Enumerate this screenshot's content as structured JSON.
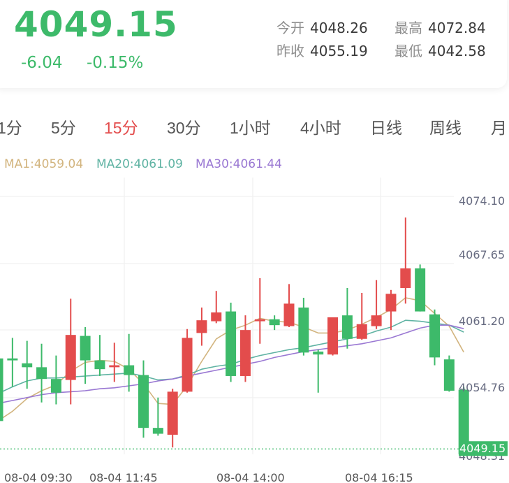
{
  "quote": {
    "price": "4049.15",
    "change": "-6.04",
    "change_pct": "-0.15%",
    "open_label": "今开",
    "open": "4048.26",
    "high_label": "最高",
    "high": "4072.84",
    "prev_close_label": "昨收",
    "prev_close": "4055.19",
    "low_label": "最低",
    "low": "4042.58"
  },
  "periods": [
    {
      "label": "1分",
      "active": false
    },
    {
      "label": "5分",
      "active": false
    },
    {
      "label": "15分",
      "active": true
    },
    {
      "label": "30分",
      "active": false
    },
    {
      "label": "1小时",
      "active": false
    },
    {
      "label": "4小时",
      "active": false
    },
    {
      "label": "日线",
      "active": false
    },
    {
      "label": "周线",
      "active": false
    },
    {
      "label": "月",
      "active": false
    }
  ],
  "ma_legend": [
    {
      "text": "MA1:4059.04",
      "color": "#d2b47e"
    },
    {
      "text": "MA20:4061.09",
      "color": "#5fb3a3"
    },
    {
      "text": "MA30:4061.44",
      "color": "#9a78d3"
    }
  ],
  "colors": {
    "up": "#e34c4c",
    "down": "#3dba6a",
    "grid": "#eeeeee"
  },
  "chart_data": {
    "type": "candlestick",
    "y_ticks": [
      "4074.10",
      "4067.65",
      "4061.20",
      "4054.76",
      "4048.31"
    ],
    "ylim": [
      4048.31,
      4074.1
    ],
    "current_price_label": "4049.15",
    "current_price": 4049.15,
    "x_labels": [
      "08-04 09:30",
      "08-04 11:45",
      "08-04 14:00",
      "08-04 16:15"
    ],
    "candles": [
      {
        "o": 4058.4,
        "c": 4052.0,
        "h": 4058.7,
        "l": 4048.4
      },
      {
        "o": 4058.4,
        "c": 4058.2,
        "h": 4060.5,
        "l": 4055.5
      },
      {
        "o": 4057.9,
        "c": 4057.5,
        "h": 4060.2,
        "l": 4055.3
      },
      {
        "o": 4057.5,
        "c": 4056.3,
        "h": 4059.9,
        "l": 4053.9
      },
      {
        "o": 4056.3,
        "c": 4054.9,
        "h": 4058.7,
        "l": 4053.7
      },
      {
        "o": 4056.2,
        "c": 4060.8,
        "h": 4064.5,
        "l": 4053.7
      },
      {
        "o": 4060.7,
        "c": 4058.2,
        "h": 4061.6,
        "l": 4055.8
      },
      {
        "o": 4058.2,
        "c": 4057.3,
        "h": 4060.8,
        "l": 4056.6
      },
      {
        "o": 4057.5,
        "c": 4057.7,
        "h": 4060.0,
        "l": 4056.0
      },
      {
        "o": 4057.7,
        "c": 4056.7,
        "h": 4060.9,
        "l": 4055.0
      },
      {
        "o": 4056.7,
        "c": 4051.3,
        "h": 4058.2,
        "l": 4050.3
      },
      {
        "o": 4051.3,
        "c": 4050.7,
        "h": 4054.4,
        "l": 4050.5
      },
      {
        "o": 4050.6,
        "c": 4055.0,
        "h": 4055.3,
        "l": 4049.3
      },
      {
        "o": 4055.0,
        "c": 4060.5,
        "h": 4061.4,
        "l": 4054.9
      },
      {
        "o": 4061.0,
        "c": 4062.3,
        "h": 4063.6,
        "l": 4059.7
      },
      {
        "o": 4062.2,
        "c": 4063.1,
        "h": 4065.3,
        "l": 4062.0
      },
      {
        "o": 4063.2,
        "c": 4056.6,
        "h": 4064.1,
        "l": 4056.0
      },
      {
        "o": 4056.6,
        "c": 4061.3,
        "h": 4062.8,
        "l": 4056.0
      },
      {
        "o": 4062.2,
        "c": 4062.4,
        "h": 4066.6,
        "l": 4059.9
      },
      {
        "o": 4062.4,
        "c": 4061.8,
        "h": 4062.8,
        "l": 4061.3
      },
      {
        "o": 4061.7,
        "c": 4064.0,
        "h": 4066.0,
        "l": 4061.6
      },
      {
        "o": 4063.6,
        "c": 4059.0,
        "h": 4064.6,
        "l": 4058.7
      },
      {
        "o": 4059.1,
        "c": 4058.8,
        "h": 4059.3,
        "l": 4054.9
      },
      {
        "o": 4058.8,
        "c": 4062.6,
        "h": 4062.6,
        "l": 4058.7
      },
      {
        "o": 4062.8,
        "c": 4060.4,
        "h": 4065.6,
        "l": 4059.4
      },
      {
        "o": 4060.4,
        "c": 4061.9,
        "h": 4065.1,
        "l": 4060.3
      },
      {
        "o": 4061.7,
        "c": 4062.8,
        "h": 4066.4,
        "l": 4061.4
      },
      {
        "o": 4063.2,
        "c": 4065.0,
        "h": 4065.4,
        "l": 4061.3
      },
      {
        "o": 4065.6,
        "c": 4067.6,
        "h": 4072.8,
        "l": 4064.0
      },
      {
        "o": 4067.6,
        "c": 4063.2,
        "h": 4068.0,
        "l": 4063.2
      },
      {
        "o": 4062.9,
        "c": 4058.5,
        "h": 4063.4,
        "l": 4057.7
      },
      {
        "o": 4058.3,
        "c": 4055.1,
        "h": 4058.7,
        "l": 4055.0
      },
      {
        "o": 4055.2,
        "c": 4048.6,
        "h": 4055.5,
        "l": 4048.3
      }
    ],
    "series": [
      {
        "name": "MA1",
        "values": [
          4052.0,
          4053.0,
          4054.3,
          4055.1,
          4055.7,
          4057.1,
          4058.0,
          4058.2,
          4058.1,
          4057.3,
          4055.8,
          4053.8,
          4053.7,
          4055.6,
          4058.1,
          4060.4,
          4061.3,
          4061.8,
          4062.5,
          4062.2,
          4062.1,
          4061.6,
          4061.0,
          4061.0,
          4061.3,
          4061.9,
          4062.6,
          4063.4,
          4064.6,
          4064.3,
          4063.0,
          4061.7,
          4059.04
        ]
      },
      {
        "name": "MA20",
        "values": [
          4054.8,
          4055.5,
          4056.1,
          4056.4,
          4056.4,
          4056.5,
          4056.6,
          4056.7,
          4056.8,
          4056.9,
          4056.6,
          4056.2,
          4056.3,
          4056.7,
          4057.3,
          4057.6,
          4057.8,
          4058.3,
          4058.7,
          4059.0,
          4059.3,
          4059.5,
          4059.8,
          4060.1,
          4060.4,
          4060.7,
          4061.2,
          4061.6,
          4062.3,
          4062.2,
          4062.0,
          4061.8,
          4061.09
        ]
      },
      {
        "name": "MA30",
        "values": [
          4053.8,
          4054.1,
          4054.4,
          4054.7,
          4054.9,
          4055.0,
          4055.1,
          4055.3,
          4055.4,
          4055.6,
          4055.8,
          4056.1,
          4056.3,
          4056.6,
          4056.9,
          4057.2,
          4057.5,
          4057.8,
          4058.1,
          4058.5,
          4058.8,
          4059.1,
          4059.3,
          4059.5,
          4059.7,
          4059.9,
          4060.2,
          4060.5,
          4061.0,
          4061.5,
          4061.8,
          4061.8,
          4061.44
        ]
      }
    ]
  }
}
